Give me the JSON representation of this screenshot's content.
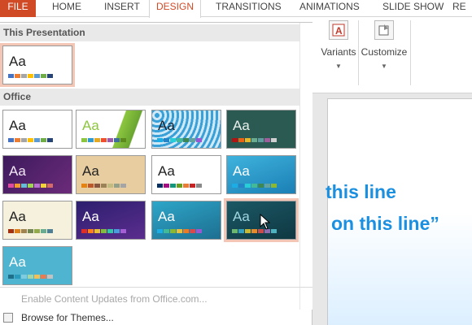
{
  "tabs": [
    "FILE",
    "HOME",
    "INSERT",
    "DESIGN",
    "TRANSITIONS",
    "ANIMATIONS",
    "SLIDE SHOW",
    "RE"
  ],
  "ribbon": {
    "variants_label": "Variants",
    "customize_label": "Customize"
  },
  "gallery": {
    "this_presentation_label": "This Presentation",
    "office_label": "Office",
    "thumb_text": "Aa",
    "enable_updates_label": "Enable Content Updates from Office.com...",
    "browse_label": "Browse for Themes..."
  },
  "slide": {
    "line1": "this line",
    "line2": "on this line”"
  },
  "colors": {
    "accent": "#d04a26",
    "selection": "#f3c6b6",
    "slide_text": "#1b8fe0"
  }
}
